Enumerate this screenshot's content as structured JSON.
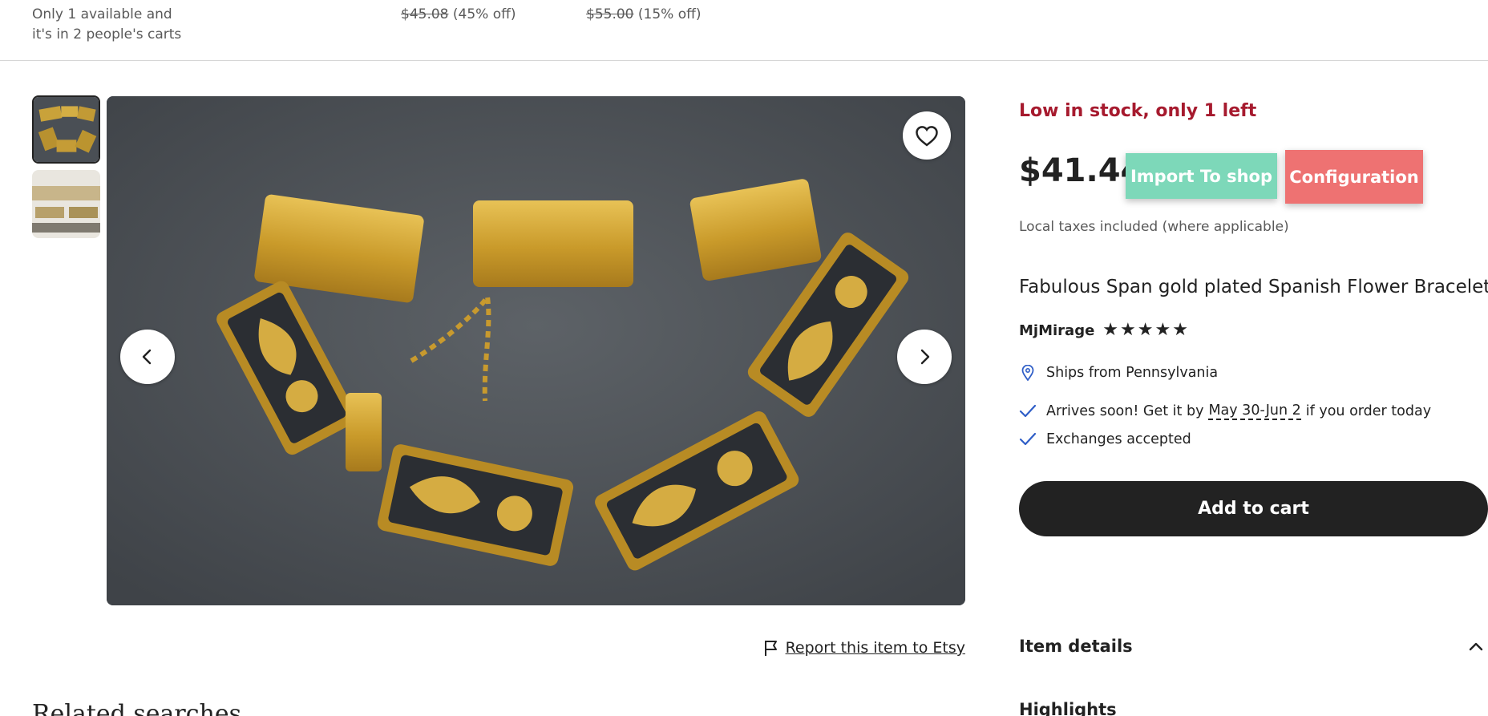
{
  "topbar": {
    "stock_note_a": "Only 1 available and",
    "stock_note_b": "it's in 2 people's carts",
    "offers": [
      {
        "was": "$45.08",
        "discount": "(45% off)"
      },
      {
        "was": "$55.00",
        "discount": "(15% off)"
      }
    ]
  },
  "gallery": {
    "thumbnail_count": 2,
    "selected_thumbnail": 1,
    "icons": {
      "favorite": "heart-icon",
      "prev": "chevron-left-icon",
      "next": "chevron-right-icon"
    }
  },
  "report": {
    "label": "Report this item to Etsy",
    "icon": "flag-icon"
  },
  "related": {
    "heading": "Related searches"
  },
  "product": {
    "stock_label": "Low in stock, only 1 left",
    "price": "$41.44",
    "import_label": "Import To shop",
    "config_label": "Configuration",
    "taxes_note": "Local taxes included (where applicable)",
    "title": "Fabulous Span gold plated Spanish Flower Bracelet",
    "shop_name": "MjMirage",
    "rating_stars": 5,
    "ships_from": "Ships from Pennsylvania",
    "arrival_prefix": "Arrives soon! Get it by",
    "arrival_dates": "May 30-Jun 2",
    "arrival_suffix": "if you order today",
    "exchanges": "Exchanges accepted",
    "add_to_cart": "Add to cart",
    "item_details": "Item details",
    "highlights": "Highlights"
  },
  "colors": {
    "low_stock": "#a61a2e",
    "import_button": "#7dd8b9",
    "config_button": "#ee7272",
    "check_icon": "#2f5ec7",
    "primary_button": "#222222"
  }
}
